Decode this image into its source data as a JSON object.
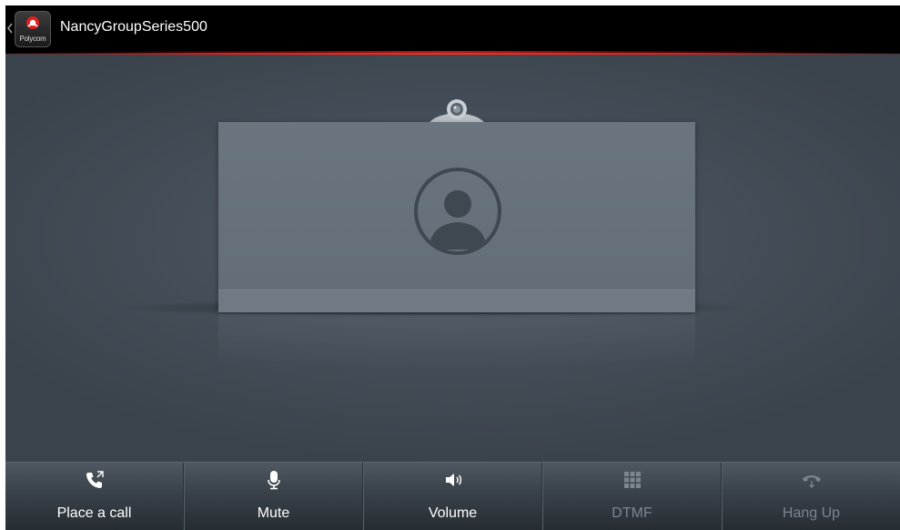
{
  "header": {
    "device_name": "NancyGroupSeries500",
    "logo_text": "Polycom",
    "accent_color": "#e0201a"
  },
  "main": {
    "avatar_icon": "person-circle-icon",
    "camera_icon": "camera-icon"
  },
  "toolbar": {
    "buttons": [
      {
        "label": "Place a call",
        "icon": "phone-outgoing-icon",
        "enabled": true
      },
      {
        "label": "Mute",
        "icon": "microphone-icon",
        "enabled": true
      },
      {
        "label": "Volume",
        "icon": "speaker-icon",
        "enabled": true
      },
      {
        "label": "DTMF",
        "icon": "keypad-icon",
        "enabled": false
      },
      {
        "label": "Hang Up",
        "icon": "hang-up-icon",
        "enabled": false
      }
    ]
  }
}
